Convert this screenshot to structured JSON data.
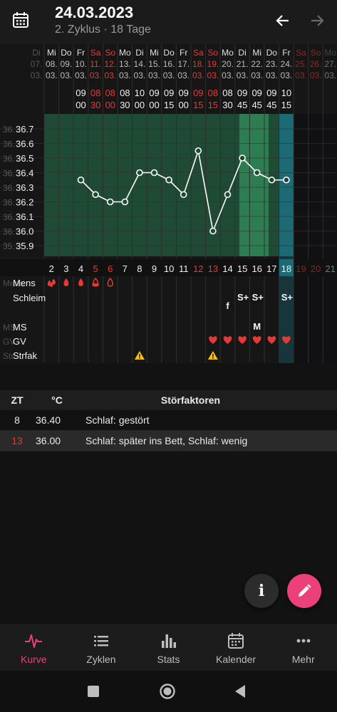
{
  "header": {
    "title": "24.03.2023",
    "subtitle": "2. Zyklus · 18 Tage"
  },
  "chart_data": {
    "type": "line",
    "title": "",
    "xlabel": "",
    "ylabel": "",
    "weekday_labels": [
      "Mi",
      "Do",
      "Fr",
      "Sa",
      "So",
      "Mo",
      "Di",
      "Mi",
      "Do",
      "Fr",
      "Sa",
      "So",
      "Mo",
      "Di",
      "Mi",
      "Do",
      "Fr",
      "Sa",
      "So",
      "Mo"
    ],
    "date_labels": [
      "08.03.",
      "09.03.",
      "10.03.",
      "11.03.",
      "12.03.",
      "13.03.",
      "14.03.",
      "15.03.",
      "16.03.",
      "17.03.",
      "18.03.",
      "19.03.",
      "20.03.",
      "21.03.",
      "22.03.",
      "23.03.",
      "24.03.",
      "25.03.",
      "26.03.",
      "27.03."
    ],
    "left_partial_weekday": [
      "Di"
    ],
    "left_partial_date": [
      "07.03."
    ],
    "time_hours": [
      "",
      "",
      "09",
      "08",
      "08",
      "08",
      "10",
      "09",
      "09",
      "09",
      "09",
      "08",
      "08",
      "09",
      "09",
      "09",
      "10",
      "",
      "",
      ""
    ],
    "time_minutes": [
      "",
      "",
      "00",
      "30",
      "00",
      "30",
      "00",
      "00",
      "15",
      "00",
      "15",
      "15",
      "30",
      "45",
      "45",
      "45",
      "15",
      "",
      "",
      ""
    ],
    "cycle_days": [
      "2",
      "3",
      "4",
      "5",
      "6",
      "7",
      "8",
      "9",
      "10",
      "11",
      "12",
      "13",
      "14",
      "15",
      "16",
      "17",
      "18",
      "19",
      "20",
      "21"
    ],
    "y_ticks": [
      "36.7",
      "36.6",
      "36.5",
      "36.4",
      "36.3",
      "36.2",
      "36.1",
      "36.0",
      "35.9"
    ],
    "y_tick_prefix": [
      "36.",
      "36.",
      "36.",
      "36.",
      "36.",
      "36.",
      "36.",
      "36.",
      "35."
    ],
    "ylim": [
      35.85,
      36.75
    ],
    "series": [
      {
        "values": [
          null,
          null,
          36.35,
          36.25,
          36.2,
          36.2,
          36.4,
          36.4,
          36.35,
          36.25,
          36.55,
          36.0,
          36.25,
          36.5,
          36.4,
          36.35,
          36.35,
          null,
          null,
          null
        ]
      }
    ],
    "row_labels": [
      "Mens",
      "Schleim",
      "MS",
      "GV",
      "Strfak"
    ],
    "row_label_prefixes": [
      "Mens",
      "",
      "MS",
      "GV",
      "Str"
    ],
    "mens_icons": [
      "drops-filled",
      "drop-filled",
      "drop-filled",
      "drop-half",
      "drop-outline"
    ],
    "schleim_values": [
      "f",
      "S+",
      "S+",
      "S+"
    ],
    "ms_values": [
      "M"
    ],
    "gv_count": 6,
    "strfak_days": [
      "8",
      "13"
    ],
    "grid": true
  },
  "table": {
    "headers": [
      "ZT",
      "°C",
      "Störfaktoren"
    ],
    "rows": [
      {
        "zt": "8",
        "temp": "36.40",
        "factors": "Schlaf: gestört",
        "highlight": false
      },
      {
        "zt": "13",
        "temp": "36.00",
        "factors": "Schlaf: später ins Bett, Schlaf: wenig",
        "highlight": true
      }
    ]
  },
  "fab": {
    "info_label": "i"
  },
  "bottom_nav": [
    {
      "label": "Kurve",
      "icon": "heartbeat-icon",
      "active": true
    },
    {
      "label": "Zyklen",
      "icon": "list-icon",
      "active": false
    },
    {
      "label": "Stats",
      "icon": "bar-chart-icon",
      "active": false
    },
    {
      "label": "Kalender",
      "icon": "calendar-icon",
      "active": false
    },
    {
      "label": "Mehr",
      "icon": "more-dots-icon",
      "active": false
    }
  ],
  "colors": {
    "accent": "#ec407a",
    "weekend_red": "#e53935",
    "chart_green": "#2e7d52",
    "chart_teal": "#1c6a73",
    "grid_line": "#2f2f2f"
  }
}
